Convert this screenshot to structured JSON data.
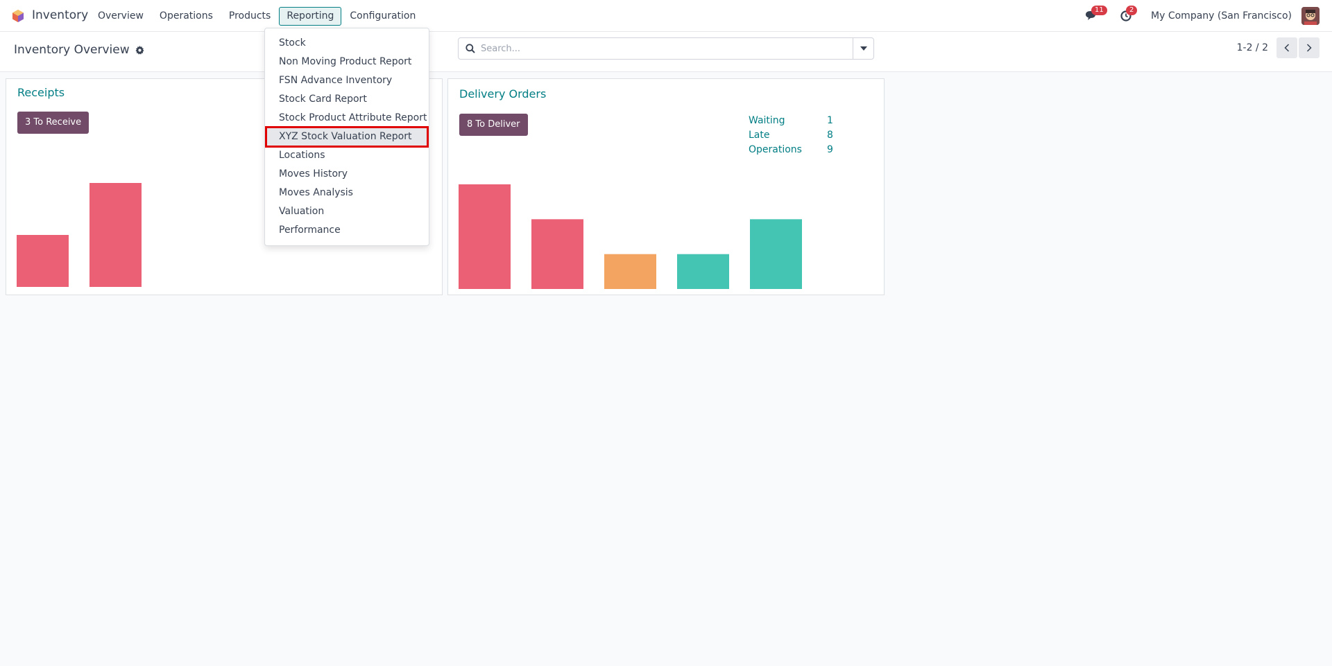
{
  "navbar": {
    "app_name": "Inventory",
    "menu": [
      "Overview",
      "Operations",
      "Products",
      "Reporting",
      "Configuration"
    ],
    "active_menu": "Reporting",
    "messages_badge": "11",
    "activities_badge": "2",
    "company": "My Company (San Francisco)"
  },
  "control_panel": {
    "title": "Inventory Overview",
    "search_placeholder": "Search...",
    "pager": "1-2 / 2"
  },
  "reporting_menu": {
    "items": [
      "Stock",
      "Non Moving Product Report",
      "FSN Advance Inventory",
      "Stock Card Report",
      "Stock Product Attribute Report",
      "XYZ Stock Valuation Report",
      "Locations",
      "Moves History",
      "Moves Analysis",
      "Valuation",
      "Performance"
    ],
    "highlighted": "XYZ Stock Valuation Report"
  },
  "cards": {
    "receipts": {
      "title": "Receipts",
      "button": "3 To Receive"
    },
    "delivery": {
      "title": "Delivery Orders",
      "button": "8 To Deliver",
      "stats": [
        {
          "label": "Waiting",
          "value": "1"
        },
        {
          "label": "Late",
          "value": "8"
        },
        {
          "label": "Operations",
          "value": "9"
        }
      ]
    }
  },
  "chart_data": [
    {
      "type": "bar",
      "values": [
        1,
        2
      ],
      "colors": [
        "#ec6076",
        "#ec6076"
      ],
      "ylim": [
        0,
        2
      ]
    },
    {
      "type": "bar",
      "values": [
        3,
        2,
        1,
        1,
        2
      ],
      "colors": [
        "#ec6076",
        "#ec6076",
        "#f2a460",
        "#44c4b3",
        "#44c4b3"
      ],
      "ylim": [
        0,
        3
      ]
    }
  ],
  "colors": {
    "brand_purple": "#714b67",
    "teal": "#017e84",
    "highlight_red": "#e10000"
  }
}
